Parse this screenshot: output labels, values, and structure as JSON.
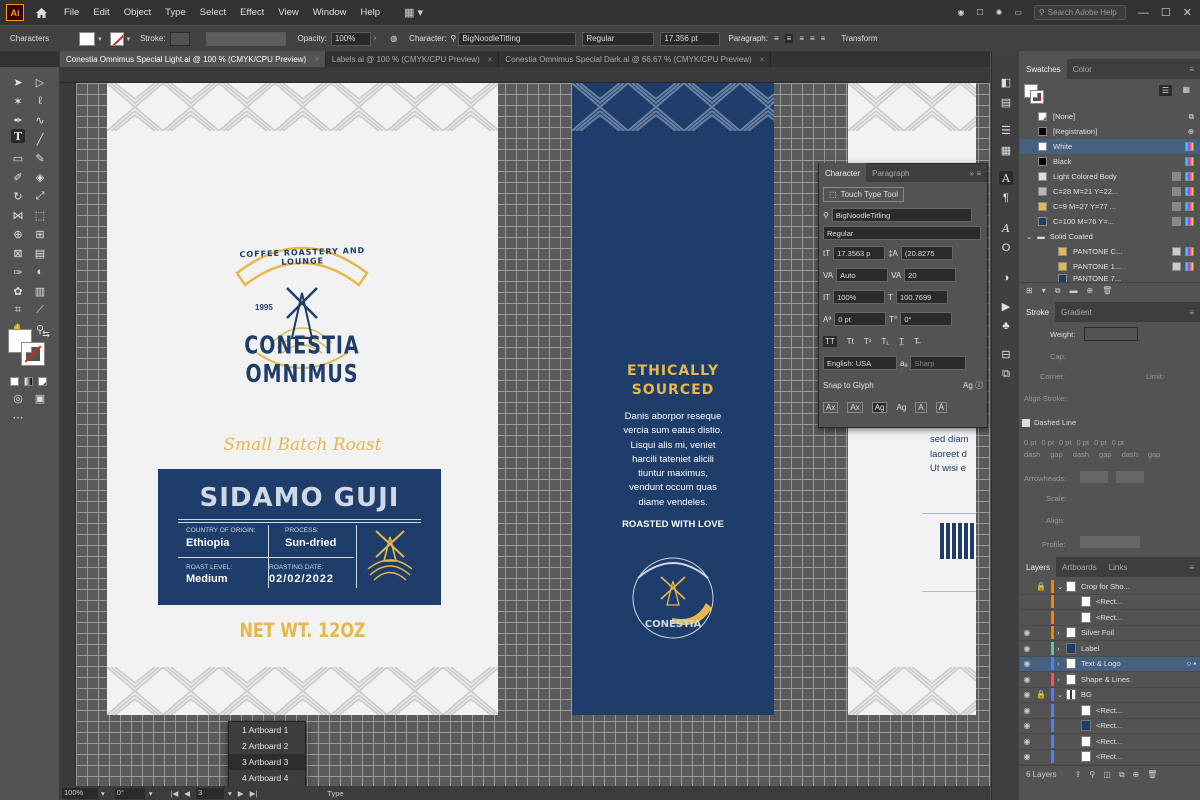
{
  "app": {
    "logo": "Ai",
    "menu": [
      "File",
      "Edit",
      "Object",
      "Type",
      "Select",
      "Effect",
      "View",
      "Window",
      "Help"
    ],
    "search_placeholder": "Search Adobe Help"
  },
  "control_bar": {
    "selection_label": "Characters",
    "stroke_label": "Stroke:",
    "opacity_label": "Opacity:",
    "opacity_value": "100%",
    "character_label": "Character:",
    "font_family": "BigNoodleTitling",
    "font_style": "Regular",
    "font_size": "17.356 pt",
    "paragraph_label": "Paragraph:",
    "transform_label": "Transform"
  },
  "tabs": [
    {
      "label": "Conestia Omnimus Special Light.ai @ 100 % (CMYK/CPU Preview)",
      "active": true
    },
    {
      "label": "Labels.ai @ 100 % (CMYK/CPU Preview)",
      "active": false
    },
    {
      "label": "Conestia Omnimus Special Dark.ai @ 66.67 % (CMYK/CPU Preview)",
      "active": false
    }
  ],
  "artwork": {
    "badge_top": "COFFEE ROASTERY AND LOUNGE",
    "badge_year": "1995",
    "badge_name": "CONESTIA OMNIMUS",
    "tagline": "Small Batch Roast",
    "product": "SIDAMO GUJI",
    "origin_label": "COUNTRY OF ORIGIN:",
    "origin_value": "Ethiopia",
    "process_label": "PROCESS:",
    "process_value": "Sun-dried",
    "roast_label": "ROAST LEVEL:",
    "roast_value": "Medium",
    "date_label": "ROASTING DATE:",
    "date_value": "02/02/2022",
    "net_weight": "NET WT. 12OZ",
    "side_heading_1": "ETHICALLY",
    "side_heading_2": "SOURCED",
    "side_body": [
      "Danis aborpor reseque",
      "vercia sum eatus distio.",
      "Lisqui alis mi, veniet",
      "harcili tateniet alicili",
      "tiuntur maximus,",
      "vendunt occum quas",
      "diame vendeles."
    ],
    "side_footer": "ROASTED WITH LOVE",
    "back_text": [
      "sed diam",
      "laoreet d",
      "Ut wisi e"
    ]
  },
  "character_panel": {
    "tab_character": "Character",
    "tab_paragraph": "Paragraph",
    "touch_type": "Touch Type Tool",
    "font_family": "BigNoodleTitling",
    "font_style": "Regular",
    "size": "17.3563 p",
    "leading": "(20.8275",
    "kerning": "Auto",
    "tracking": "20",
    "vscale": "100%",
    "hscale": "100.7699",
    "baseline": "0 pt",
    "rotation": "0°",
    "language": "English: USA",
    "antialias": "Sharp",
    "snap_label": "Snap to Glyph"
  },
  "swatches_panel": {
    "tab_swatches": "Swatches",
    "tab_color": "Color",
    "rows": [
      {
        "name": "[None]",
        "color": "none"
      },
      {
        "name": "[Registration]",
        "color": "#000000"
      },
      {
        "name": "White",
        "color": "#ffffff",
        "selected": true
      },
      {
        "name": "Black",
        "color": "#000000"
      },
      {
        "name": "Light Colored Body",
        "color": "#dddddd"
      },
      {
        "name": "C=28 M=21 Y=22...",
        "color": "#b7b7b7"
      },
      {
        "name": "C=9 M=27 Y=77 ...",
        "color": "#e6b84c"
      },
      {
        "name": "C=100 M=76 Y=...",
        "color": "#1e3d6b"
      },
      {
        "name": "Solid Coated",
        "color": "folder"
      },
      {
        "name": "PANTONE C...",
        "color": "#e6b84c"
      },
      {
        "name": "PANTONE 1...",
        "color": "#e6b84c"
      },
      {
        "name": "PANTONE 7...",
        "color": "#1e3d6b"
      }
    ]
  },
  "stroke_panel": {
    "tab_stroke": "Stroke",
    "tab_gradient": "Gradient",
    "weight_label": "Weight:",
    "cap_label": "Cap:",
    "corner_label": "Corner:",
    "limit_label": "Limit:",
    "align_label": "Align Stroke:",
    "dashed_label": "Dashed Line",
    "dash_fields": [
      "0 pt",
      "0 pt",
      "0 pt",
      "0 pt",
      "0 pt",
      "0 pt"
    ],
    "dash_captions": [
      "dash",
      "gap",
      "dash",
      "gap",
      "dash",
      "gap"
    ],
    "arrowheads_label": "Arrowheads:",
    "scale_label": "Scale:",
    "align_label2": "Align:",
    "profile_label": "Profile:"
  },
  "layers_panel": {
    "tab_layers": "Layers",
    "tab_artboards": "Artboards",
    "tab_links": "Links",
    "rows": [
      {
        "name": "Crop for Sho...",
        "bar": "#ff7f00",
        "locked": true,
        "expanded": true
      },
      {
        "name": "<Rect...",
        "bar": "#ff7f00",
        "indent": true
      },
      {
        "name": "<Rect...",
        "bar": "#ff7f00",
        "indent": true
      },
      {
        "name": "Silver Foil",
        "bar": "#ff7f00"
      },
      {
        "name": "Label",
        "bar": "#4fcf9f"
      },
      {
        "name": "Text & Logo",
        "bar": "#4f7fff",
        "selected": true
      },
      {
        "name": "Shape & Lines",
        "bar": "#ff4f4f"
      },
      {
        "name": "BG",
        "bar": "#4f7fff",
        "locked": true,
        "expanded": true
      },
      {
        "name": "<Rect...",
        "bar": "#4f7fff",
        "indent": true
      },
      {
        "name": "<Rect...",
        "bar": "#4f7fff",
        "indent": true
      },
      {
        "name": "<Rect...",
        "bar": "#4f7fff",
        "indent": true
      },
      {
        "name": "<Rect...",
        "bar": "#4f7fff",
        "indent": true
      }
    ],
    "count": "6 Layers"
  },
  "status": {
    "zoom": "100%",
    "rotation": "0°",
    "artboard_num": "3",
    "tool": "Type"
  },
  "artboard_menu": [
    "1 Artboard 1",
    "2 Artboard 2",
    "3 Artboard 3",
    "4 Artboard 4"
  ],
  "colors": {
    "navy": "#1e3d6b",
    "gold": "#e6b84c",
    "paper": "#f2f2f2"
  }
}
